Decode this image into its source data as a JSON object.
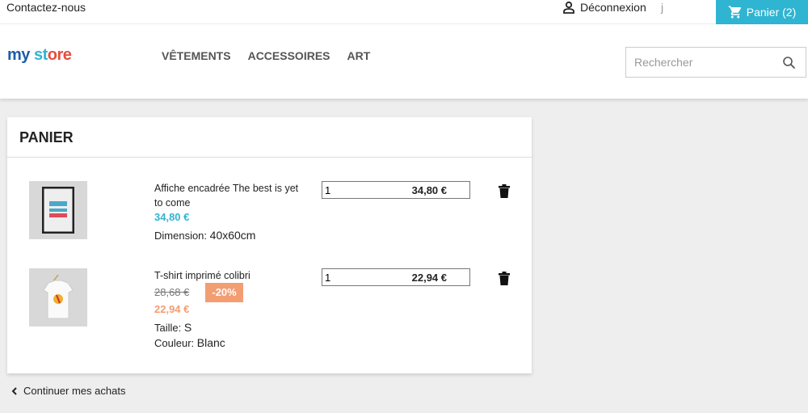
{
  "topbar": {
    "contact": "Contactez-nous",
    "logout": "Déconnexion",
    "user_partial": "j",
    "cart": "Panier (2)"
  },
  "header": {
    "logo": "my store",
    "nav": [
      "VÊTEMENTS",
      "ACCESSOIRES",
      "ART"
    ],
    "search_placeholder": "Rechercher"
  },
  "cart": {
    "title": "PANIER",
    "items": [
      {
        "name": "Affiche encadrée The best is yet to come",
        "price": "34,80 €",
        "attrs": [
          {
            "label": "Dimension:",
            "value": "40x60cm"
          }
        ],
        "qty": "1",
        "total": "34,80 €"
      },
      {
        "name": "T-shirt imprimé colibri",
        "old_price": "28,68 €",
        "discount": "-20%",
        "price": "22,94 €",
        "attrs": [
          {
            "label": "Taille:",
            "value": "S"
          },
          {
            "label": "Couleur:",
            "value": "Blanc"
          }
        ],
        "qty": "1",
        "total": "22,94 €"
      }
    ],
    "continue": "Continuer mes achats"
  },
  "colors": {
    "accent": "#2fb5d2",
    "discount": "#f39d72"
  }
}
